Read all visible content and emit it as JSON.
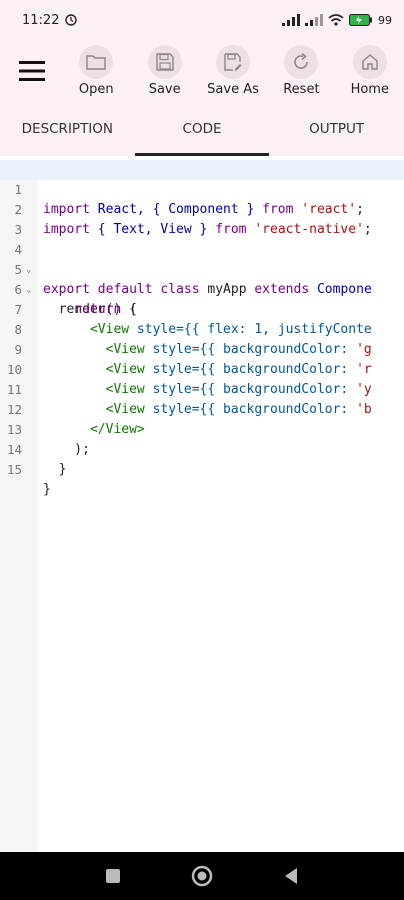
{
  "status": {
    "time": "11:22",
    "battery": "99"
  },
  "toolbar": {
    "open_label": "Open",
    "save_label": "Save",
    "save_as_label": "Save As",
    "reset_label": "Reset",
    "home_label": "Home"
  },
  "tabs": {
    "description": "DESCRIPTION",
    "code": "CODE",
    "output": "OUTPUT"
  },
  "editor": {
    "lines": [
      {
        "num": "1",
        "t1": "import",
        "t2": " React, { Component } ",
        "t3": "from",
        "t4": " ",
        "t5": "'react'",
        "t6": ";"
      },
      {
        "num": "2",
        "t1": "import",
        "t2": " { Text, View } ",
        "t3": "from",
        "t4": " ",
        "t5": "'react-native'",
        "t6": ";"
      },
      {
        "num": "3"
      },
      {
        "num": "4",
        "fold": "⌄",
        "k1": "export",
        "k2": "default",
        "k3": "class",
        "name": "myApp",
        "k4": "extends",
        "sup": "Compone"
      },
      {
        "num": "5",
        "fold": "⌄",
        "text": "  render() {"
      },
      {
        "num": "6",
        "k1": "return",
        "rest": " ("
      },
      {
        "num": "7",
        "tag": "<View",
        "rest": " style={{ flex: 1, justifyConte"
      },
      {
        "num": "8",
        "tag": "<View",
        "rest": " style={{ backgroundColor: ",
        "str": "'g"
      },
      {
        "num": "9",
        "tag": "<View",
        "rest": " style={{ backgroundColor: ",
        "str": "'r"
      },
      {
        "num": "10",
        "tag": "<View",
        "rest": " style={{ backgroundColor: ",
        "str": "'y"
      },
      {
        "num": "11",
        "tag": "<View",
        "rest": " style={{ backgroundColor: ",
        "str": "'b"
      },
      {
        "num": "12",
        "tag": "</View>"
      },
      {
        "num": "13",
        "text": "    );"
      },
      {
        "num": "14",
        "text": "  }"
      },
      {
        "num": "15",
        "text": "}"
      }
    ]
  }
}
